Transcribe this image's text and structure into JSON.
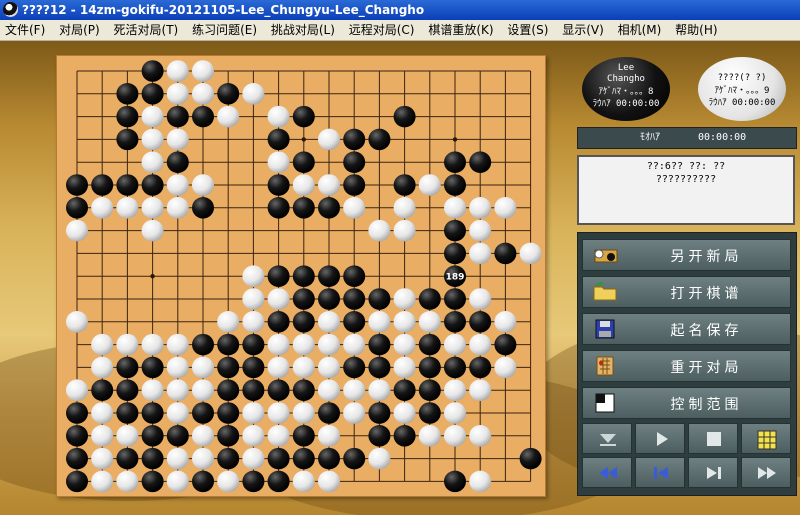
{
  "window": {
    "title": "????12 - 14zm-gokifu-20121105-Lee_Chungyu-Lee_Changho"
  },
  "menu": [
    "文件(F)",
    "对局(P)",
    "死活对局(T)",
    "练习问题(E)",
    "挑战对局(L)",
    "远程对局(C)",
    "棋谱重放(K)",
    "设置(S)",
    "显示(V)",
    "相机(M)",
    "帮助(H)"
  ],
  "players": {
    "black": {
      "line1": "Lee",
      "line2": "Changho",
      "line3": "ｱｹﾞﾊﾏ・。。。8",
      "line4": "ﾗｳﾊｱ 00:00:00"
    },
    "white": {
      "line1": "????(? ?)",
      "line2": "ｱｹﾞﾊﾏ・。。。9",
      "line3": "ﾗｳﾊｱ 00:00:00"
    }
  },
  "timer": {
    "label": "ﾓｵﾊｱ",
    "value": "00:00:00"
  },
  "info": {
    "line1": "??:6??      ??: ??",
    "line2": "??????????"
  },
  "actions": [
    "另开新局",
    "打开棋谱",
    "起名保存",
    "重开对局",
    "控制范围"
  ],
  "board": {
    "size": 19,
    "last_move_label": "189",
    "last_move": "Q10",
    "rows": [
      "...BWW.............",
      "..BBWWBW...........",
      "..BWBBW.WB...B.....",
      "..BWW...B.WBB......",
      "...WB...WB.B...BB..",
      "BBBBWW..BWWB.BWB...",
      "BWWWWB..BBBW.W.WWW.",
      "W..W........WW.BW..",
      "...............BWBW",
      ".......WBBBB.......",
      ".......WWBBBBWBBW..",
      "W.....WWBBWBWWWBBW.",
      ".WWWWBBBWWWWBWBWWB.",
      ".WBBWWBBWWWBBWBBBW.",
      "WBBWWWBBBBWWWBBWW..",
      "BWBBWBBWWWBWBWBW...",
      "BWWBBWBWWBW.BBWWW..",
      "BWBBWWBWBBBBW.....B",
      "BWWBWBWBBWW....BW.."
    ]
  }
}
